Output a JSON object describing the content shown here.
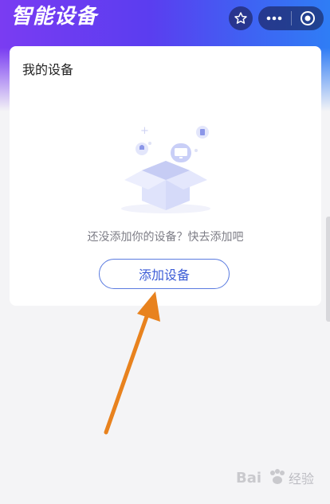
{
  "header": {
    "title": "智能设备",
    "favorite_icon": "star-icon",
    "more_icon": "more-dots-icon",
    "close_icon": "target-circle-icon"
  },
  "card": {
    "title": "我的设备",
    "empty_message": "还没添加你的设备？快去添加吧",
    "add_button_label": "添加设备",
    "illustration_icon": "empty-box-devices-icon"
  },
  "overlay": {
    "arrow_icon": "orange-arrow-icon",
    "arrow_color": "#e8821e"
  },
  "watermark": {
    "icon": "baidu-paw-icon",
    "text": "经验"
  },
  "colors": {
    "header_gradient_start": "#7a3cf2",
    "header_gradient_end": "#2f7df5",
    "button_accent": "#3c5cd6"
  }
}
